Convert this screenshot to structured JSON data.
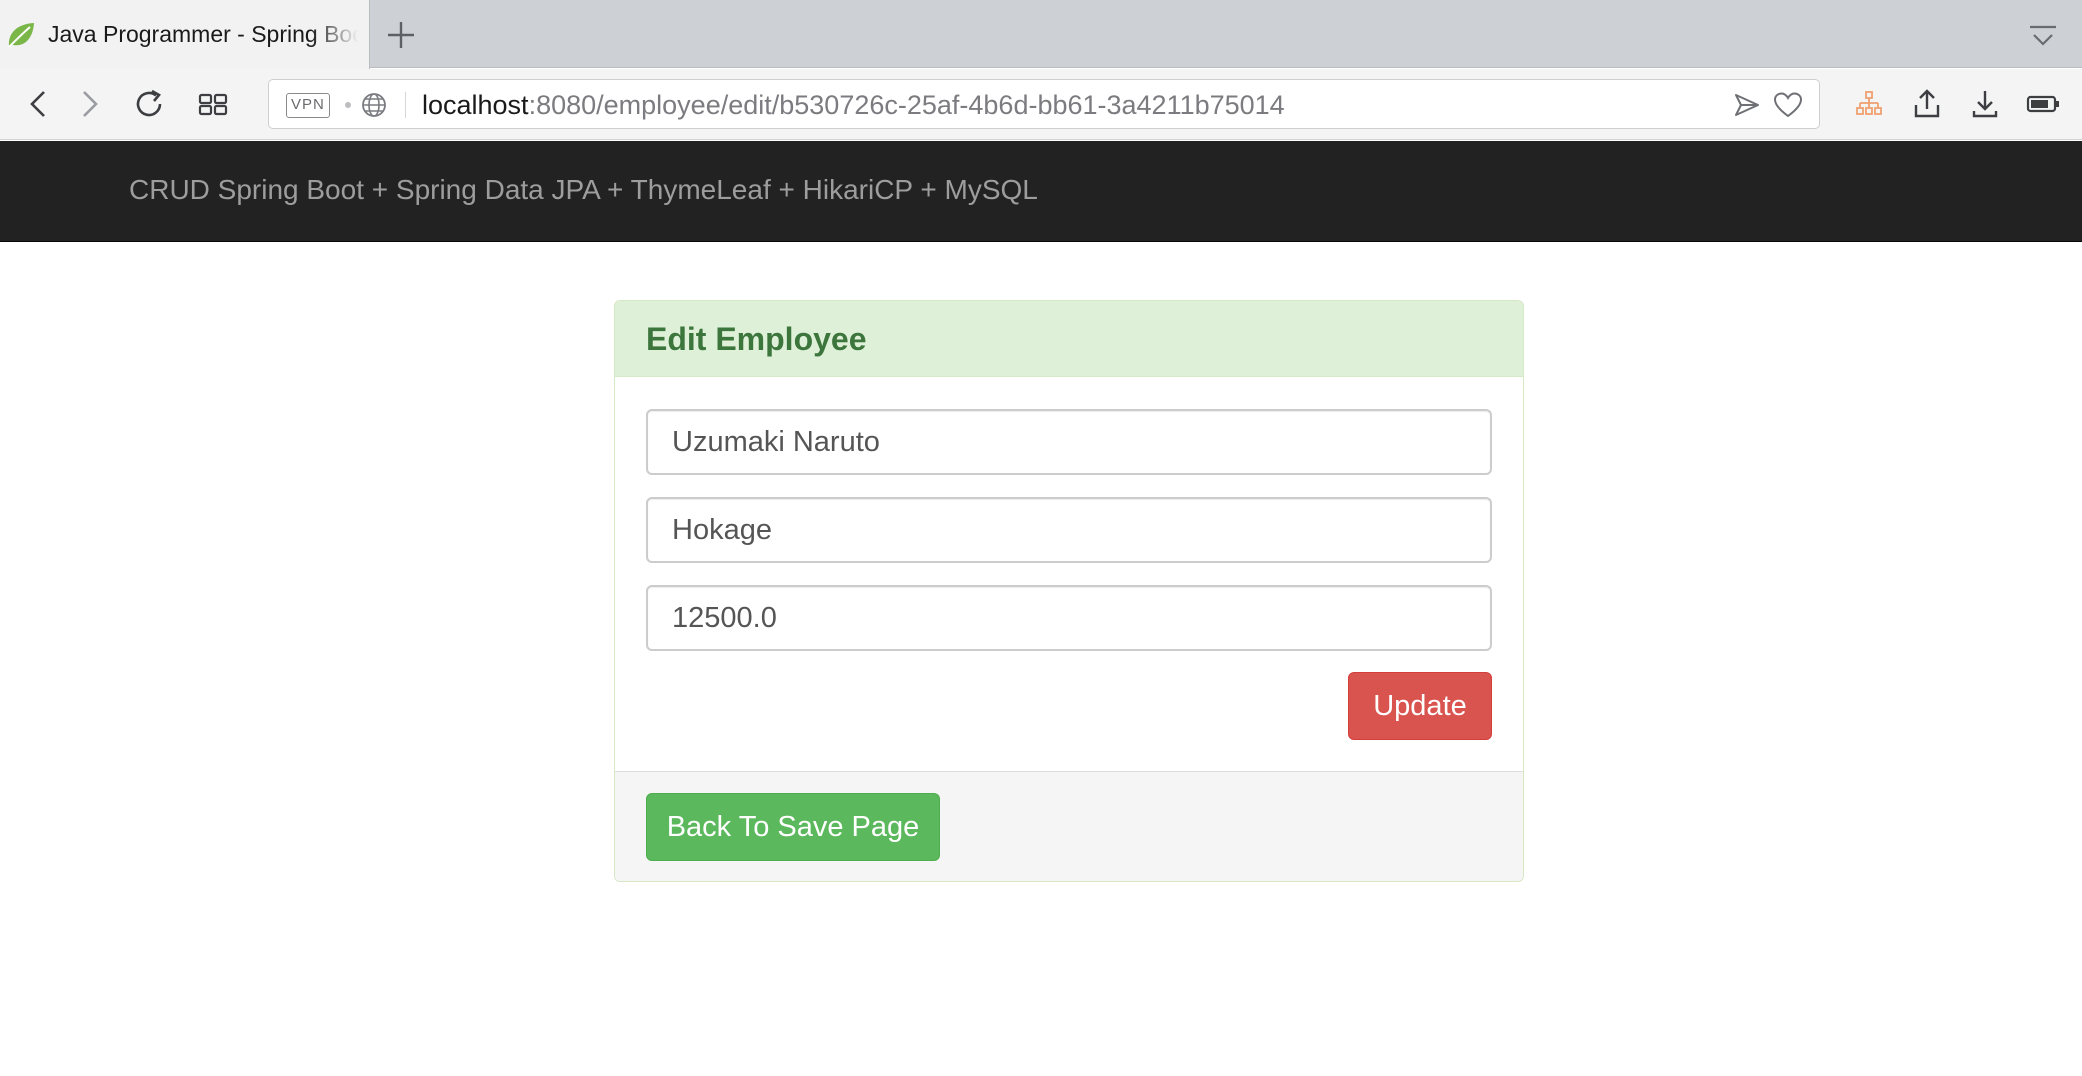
{
  "browser": {
    "tab_title": "Java Programmer - Spring Boot",
    "url_host": "localhost",
    "url_rest": ":8080/employee/edit/b530726c-25af-4b6d-bb61-3a4211b75014",
    "vpn_label": "VPN"
  },
  "navbar": {
    "brand": "CRUD Spring Boot + Spring Data JPA + ThymeLeaf + HikariCP + MySQL"
  },
  "panel": {
    "title": "Edit Employee",
    "fields": {
      "name": "Uzumaki Naruto",
      "position": "Hokage",
      "salary": "12500.0"
    },
    "update_label": "Update",
    "back_label": "Back To Save Page"
  },
  "colors": {
    "navbar_bg": "#222222",
    "panel_heading_bg": "#dff0d8",
    "panel_title": "#3c763d",
    "update_button": "#d9534f",
    "back_button": "#5cb85c"
  }
}
